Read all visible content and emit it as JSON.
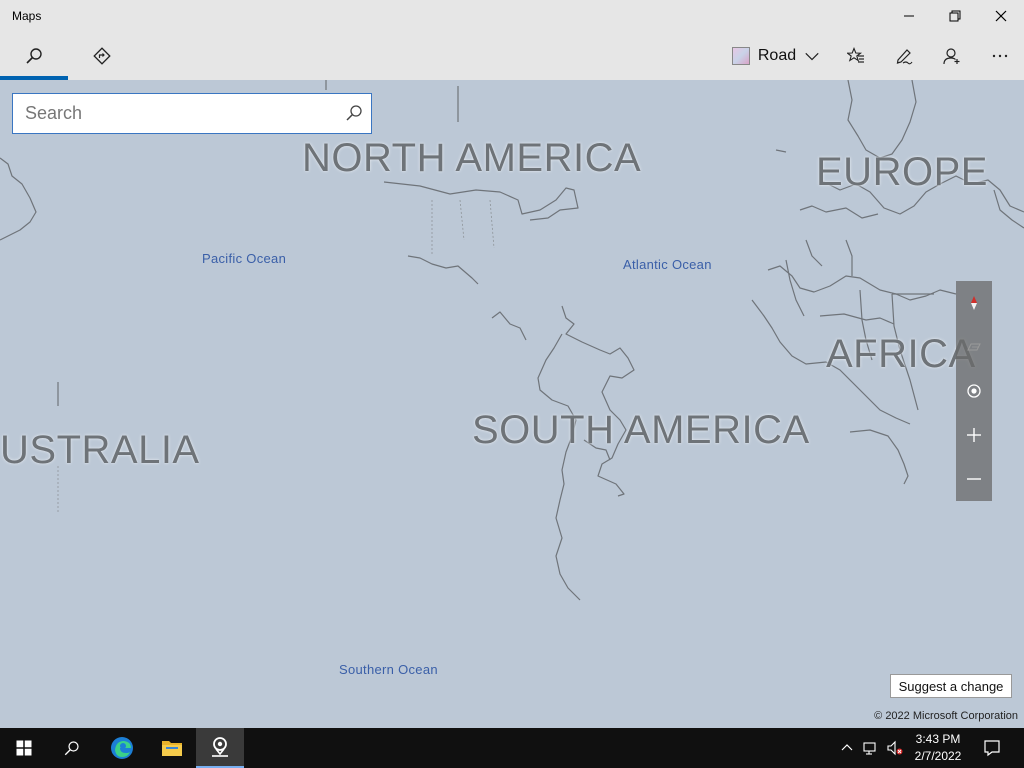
{
  "window": {
    "title": "Maps"
  },
  "toolbar": {
    "map_style_label": "Road"
  },
  "search": {
    "placeholder": "Search",
    "value": ""
  },
  "map": {
    "continents": {
      "north_america": "NORTH AMERICA",
      "europe": "EUROPE",
      "africa": "AFRICA",
      "south_america": "SOUTH AMERICA",
      "australia": "USTRALIA"
    },
    "oceans": {
      "pacific": "Pacific Ocean",
      "atlantic": "Atlantic Ocean",
      "southern": "Southern Ocean"
    },
    "suggest_label": "Suggest a change",
    "copyright": "© 2022 Microsoft Corporation"
  },
  "taskbar": {
    "time": "3:43 PM",
    "date": "2/7/2022"
  },
  "colors": {
    "accent": "#0063b1",
    "map_water": "#bcc8d6",
    "chrome": "#e6e6e6",
    "taskbar": "#101010"
  },
  "icons": {
    "search": "search-icon",
    "directions": "directions-icon",
    "favorites": "favorites-icon",
    "ink": "ink-pen-icon",
    "account": "account-icon",
    "more": "more-icon"
  }
}
